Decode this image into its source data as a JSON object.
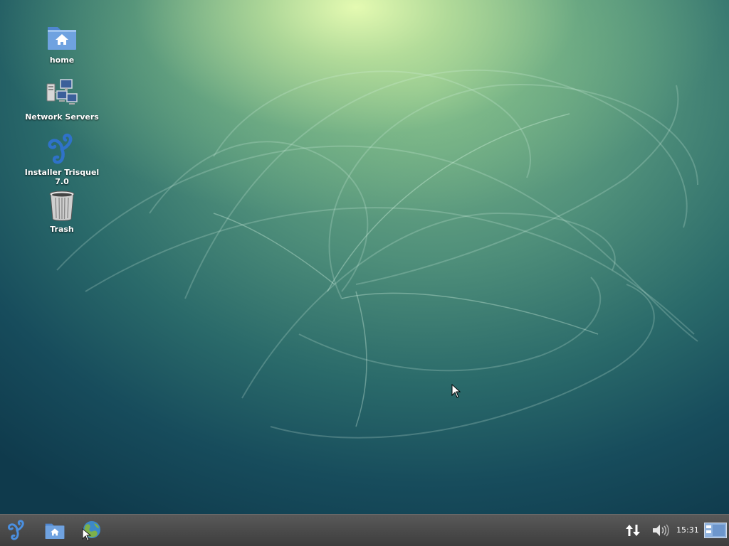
{
  "desktop": {
    "icons": [
      {
        "label": "home",
        "icon": "home-folder-icon"
      },
      {
        "label": "Network Servers",
        "icon": "network-computers-icon"
      },
      {
        "label": "Installer Trisquel 7.0",
        "icon": "trisquel-triskelion-icon"
      },
      {
        "label": "Trash",
        "icon": "trash-can-icon"
      }
    ]
  },
  "taskbar": {
    "launchers": [
      {
        "name": "application-menu",
        "icon": "trisquel-triskelion-icon"
      },
      {
        "name": "file-manager",
        "icon": "home-folder-icon"
      },
      {
        "name": "web-browser",
        "icon": "globe-browser-icon"
      }
    ],
    "tray": {
      "network_icon": "network-up-down-arrows-icon",
      "volume_icon": "speaker-volume-icon",
      "clock": "15:31",
      "desktop_switcher_icon": "desktop-pager-icon"
    }
  },
  "colors": {
    "taskbar_bg": "#4a4a4a",
    "desktop_top": "#e6fcb4",
    "desktop_bottom": "#0f3a4c",
    "icon_blue": "#2f72c9"
  }
}
